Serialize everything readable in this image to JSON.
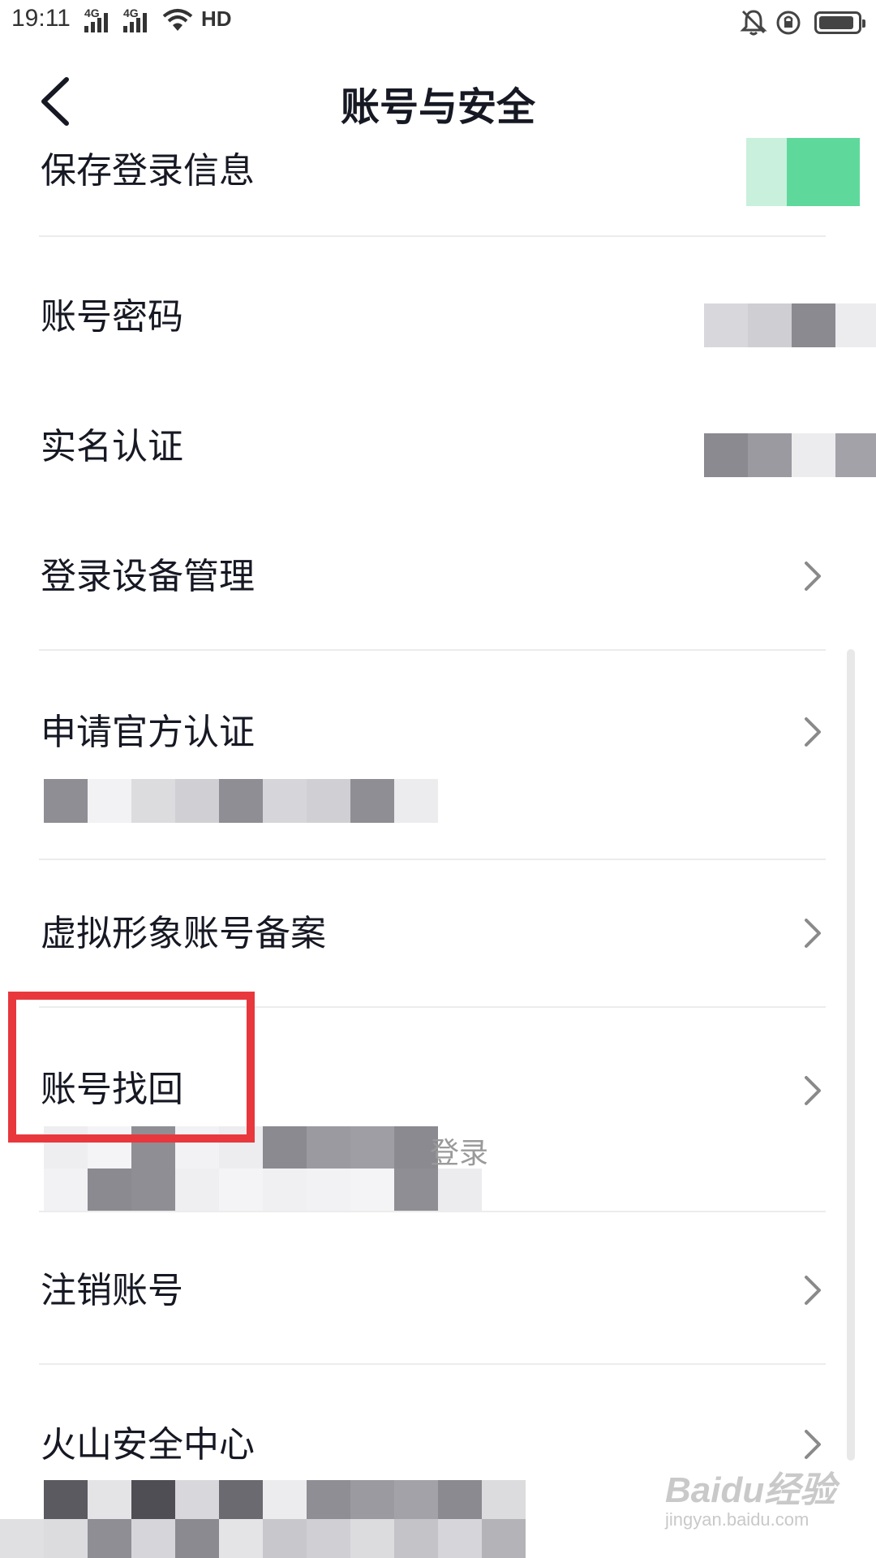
{
  "status_bar": {
    "time": "19:11",
    "network_1": "4G",
    "network_2": "4G",
    "hd_label": "HD"
  },
  "header": {
    "title": "账号与安全"
  },
  "settings": {
    "save_login_info": "保存登录信息",
    "account_password": "账号密码",
    "real_name_verification": "实名认证",
    "login_device_management": "登录设备管理",
    "apply_official_verification": "申请官方认证",
    "virtual_avatar_filing": "虚拟形象账号备案",
    "account_recovery": "账号找回",
    "account_recovery_sub_suffix": "登录",
    "cancel_account": "注销账号",
    "volcano_security_center": "火山安全中心"
  },
  "watermark": {
    "logo": "Baidu经验",
    "site": "jingyan.baidu.com"
  },
  "colors": {
    "toggle_green": "#5fd89c",
    "highlight_red": "#e8383d",
    "text_primary": "#161823",
    "chevron": "#8a8a8a"
  }
}
